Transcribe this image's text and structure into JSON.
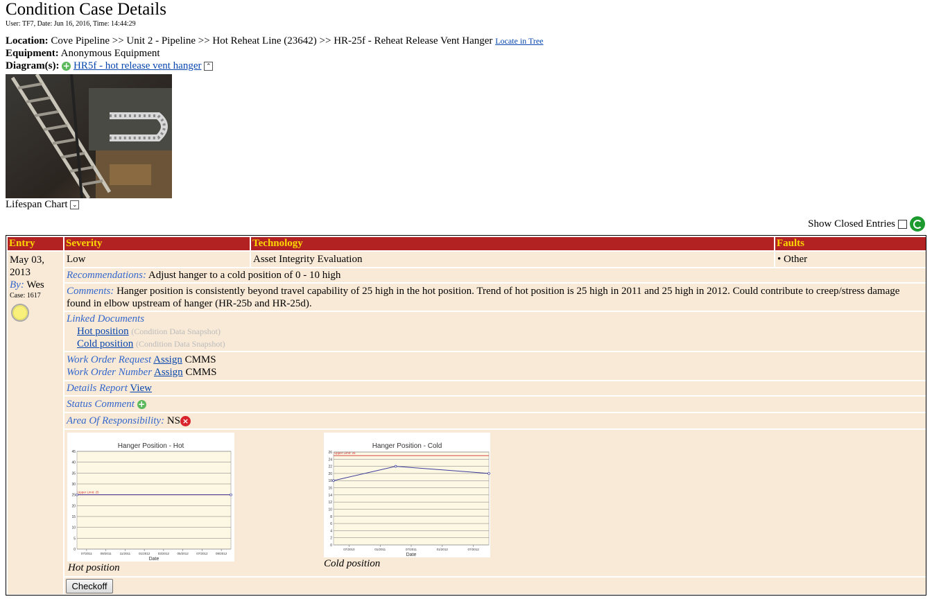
{
  "page": {
    "title": "Condition Case Details",
    "user_line": "User: TF7, Date: Jun 16, 2016, Time: 14:44:29"
  },
  "location": {
    "label": "Location:",
    "value": "Cove Pipeline >> Unit 2 - Pipeline >> Hot Reheat Line (23642) >> HR-25f - Reheat Release Vent Hanger",
    "locate_link": "Locate in Tree"
  },
  "equipment": {
    "label": "Equipment:",
    "value": "Anonymous Equipment"
  },
  "diagrams": {
    "label": "Diagram(s):",
    "link": "HR5f - hot release vent hanger",
    "collapse_glyph": "⌃"
  },
  "lifespan": {
    "label": "Lifespan Chart",
    "expand_glyph": "⌄"
  },
  "show_closed": {
    "label": "Show Closed Entries"
  },
  "table": {
    "headers": {
      "entry": "Entry",
      "severity": "Severity",
      "technology": "Technology",
      "faults": "Faults"
    },
    "entry_date_1": "May 03,",
    "entry_date_2": "2013",
    "by_label": "By:",
    "by_value": "Wes",
    "case": "Case: 1617",
    "severity": "Low",
    "technology": "Asset Integrity Evaluation",
    "fault": "• Other",
    "recommendations_label": "Recommendations:",
    "recommendations": "Adjust hanger to a cold position of 0 - 10 high",
    "comments_label": "Comments:",
    "comments": "Hanger position is consistently beyond travel capability of 25 high in the hot position. Trend of hot position is 25 high in 2011 and 25 high in 2012. Could contribute to creep/stress damage found in elbow upstream of hanger (HR-25b and HR-25d).",
    "linked_docs_label": "Linked Documents",
    "doc1": "Hot position",
    "doc1_note": "(Condition Data Snapshot)",
    "doc2": "Cold position",
    "doc2_note": "(Condition Data Snapshot)",
    "wor_label": "Work Order Request",
    "wor_assign": "Assign",
    "wor_system": "CMMS",
    "won_label": "Work Order Number",
    "won_assign": "Assign",
    "won_system": "CMMS",
    "details_label": "Details Report",
    "details_view": "View",
    "status_label": "Status Comment",
    "aor_label": "Area Of Responsibility:",
    "aor_value": "NS",
    "hot_caption": "Hot position",
    "cold_caption": "Cold position",
    "checkoff": "Checkoff"
  },
  "colors": {
    "header_bg": "#b22222",
    "header_text": "#ffd700",
    "row_bg": "#f9ead7",
    "label_blue": "#3366cc"
  },
  "chart_data": [
    {
      "type": "line",
      "title": "Hanger Position - Hot",
      "xlabel": "Date",
      "ylabel": "",
      "ylim": [
        0,
        45
      ],
      "yticks": [
        "0",
        "5",
        "10",
        "15",
        "20",
        "25",
        "30",
        "35",
        "40",
        "45"
      ],
      "xticks": [
        "07/2011",
        "09/2011",
        "11/2011",
        "01/2012",
        "03/2012",
        "05/2012",
        "07/2012",
        "09/2012"
      ],
      "limit_label": "Upper Limit: 25",
      "limit": 25,
      "grid": true,
      "series": [
        {
          "values": [
            25,
            25
          ]
        }
      ],
      "x_positions": [
        0,
        1
      ]
    },
    {
      "type": "line",
      "title": "Hanger Position - Cold",
      "xlabel": "Date",
      "ylabel": "",
      "ylim": [
        0,
        26
      ],
      "yticks": [
        "0",
        "2",
        "4",
        "6",
        "8",
        "10",
        "12",
        "14",
        "16",
        "18",
        "20",
        "22",
        "24",
        "26"
      ],
      "xticks": [
        "07/2010",
        "01/2011",
        "07/2011",
        "01/2012",
        "07/2012"
      ],
      "limit_label": "Upper Limit: 25",
      "limit": 25,
      "grid": true,
      "series": [
        {
          "values": [
            18,
            22,
            20
          ]
        }
      ],
      "x_positions": [
        0,
        0.4,
        1
      ]
    }
  ]
}
